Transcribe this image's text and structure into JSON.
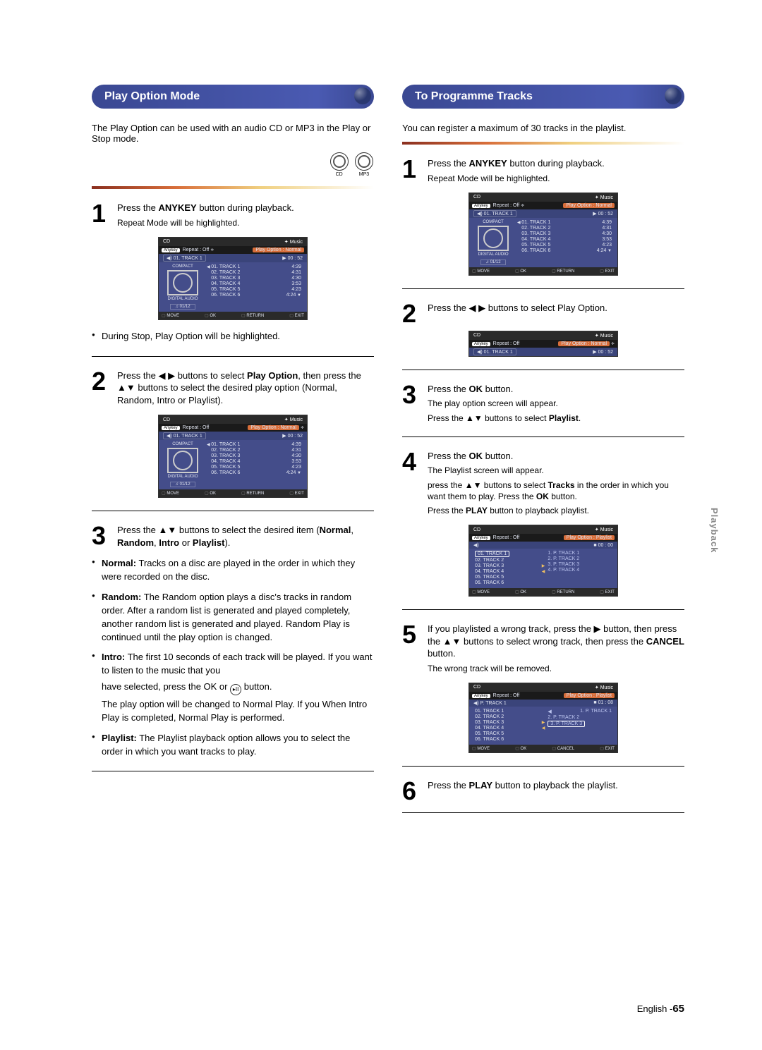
{
  "side_tab": "Playback",
  "footer_lang": "English -",
  "footer_page": "65",
  "badges": {
    "cd": "CD",
    "mp3": "MP3"
  },
  "left": {
    "header": "Play Option Mode",
    "intro": "The Play Option can be used with an audio CD or MP3 in the Play or Stop mode.",
    "step1_pre": "Press the ",
    "step1_b": "ANYKEY",
    "step1_post": " button during playback.",
    "step1_sub": "Repeat Mode will be highlighted.",
    "bullet1": "During Stop, Play Option will be highlighted.",
    "step2_a": "Press the ◀ ▶ buttons to select ",
    "step2_b": "Play Option",
    "step2_c": ", then press the ▲▼ buttons to select the desired play option (Normal, Random, Intro or Playlist).",
    "step3_a": "Press the ▲▼ buttons to select the desired item (",
    "step3_b1": "Normal",
    "step3_s1": ", ",
    "step3_b2": "Random",
    "step3_s2": ", ",
    "step3_b3": "Intro",
    "step3_s3": " or ",
    "step3_b4": "Playlist",
    "step3_e": ").",
    "opt_normal_h": "Normal:",
    "opt_normal_t": " Tracks on a disc are played in the order in which they were recorded on the disc.",
    "opt_random_h": "Random:",
    "opt_random_t": " The Random option plays a disc's tracks in random order. After a random list is generated and played completely, another random list is generated and played. Random Play is continued until the play option is changed.",
    "opt_intro_h": "Intro:",
    "opt_intro_t": " The first 10 seconds of each track will be played. If you want to listen to the music that you",
    "opt_intro_line2a": "have selected, press the OK or ",
    "opt_intro_line2b": " button.",
    "opt_intro_line3": "The play option will be changed to Normal Play. If you When Intro Play is completed, Normal Play is performed.",
    "opt_play_h": "Playlist:",
    "opt_play_t": " The Playlist playback option allows you to select the order in which you want tracks to play."
  },
  "right": {
    "header": "To Programme Tracks",
    "intro": "You can register a maximum of 30 tracks in the playlist.",
    "step1_pre": "Press the ",
    "step1_b": "ANYKEY",
    "step1_post": " button during playback.",
    "step1_sub": "Repeat Mode will be highlighted.",
    "step2": "Press the ◀ ▶ buttons to select Play Option.",
    "step3_a": "Press the ",
    "step3_b": "OK",
    "step3_c": " button.",
    "step3_sub1": "The play option screen will appear.",
    "step3_sub2a": "Press the ▲▼ buttons to select ",
    "step3_sub2b": "Playlist",
    "step3_sub2c": ".",
    "step4_a": "Press the ",
    "step4_b": "OK",
    "step4_c": " button.",
    "step4_sub1": "The Playlist screen will appear.",
    "step4_sub2a": "press the ▲▼ buttons to select ",
    "step4_sub2b": "Tracks",
    "step4_sub2c": " in the order in which you want them to play. Press the ",
    "step4_sub2d": "OK",
    "step4_sub2e": " button.",
    "step4_sub3a": "Press the ",
    "step4_sub3b": "PLAY",
    "step4_sub3c": " button to playback playlist.",
    "step5_a": "If you playlisted a wrong track, press the ▶ button, then press the ▲▼ buttons to select wrong track, then press the ",
    "step5_b": "CANCEL",
    "step5_c": " button.",
    "step5_sub": "The wrong track will be removed.",
    "step6_a": "Press the ",
    "step6_b": "PLAY",
    "step6_c": " button to playback the playlist."
  },
  "ss_common": {
    "cd": "CD",
    "music": "Music",
    "anykey": "Anykey",
    "repeat_off": "Repeat : Off",
    "repeat_arrows": "≑",
    "play_opt_normal": "Play Option : Normal",
    "play_opt_normal_arrows": "≑",
    "play_opt_playlist": "Play Option : Playlist",
    "now_trk": "01. TRACK 1",
    "p_trk": "P. TRACK 1",
    "time52": "00 : 52",
    "time00": "00 : 00",
    "time108": "01 : 08",
    "count": "01/12",
    "compact": "COMPACT",
    "digital": "DIGITAL AUDIO",
    "move": "MOVE",
    "ok": "OK",
    "return": "RETURN",
    "exit": "EXIT",
    "cancel": "CANCEL",
    "tracks": [
      {
        "n": "01. TRACK 1",
        "d": "4:39"
      },
      {
        "n": "02. TRACK 2",
        "d": "4:31"
      },
      {
        "n": "03. TRACK 3",
        "d": "4:30"
      },
      {
        "n": "04. TRACK 4",
        "d": "3:53"
      },
      {
        "n": "05. TRACK 5",
        "d": "4:23"
      },
      {
        "n": "06. TRACK 6",
        "d": "4:24"
      }
    ],
    "ptracks": [
      "1. P. TRACK 1",
      "2. P. TRACK 2",
      "3. P. TRACK 3",
      "4. P. TRACK 4"
    ],
    "ptracks3": [
      "1. P. TRACK 1",
      "2. P. TRACK 2",
      "3. P. TRACK 3"
    ]
  }
}
